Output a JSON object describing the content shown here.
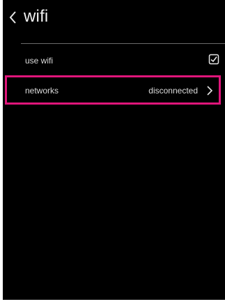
{
  "header": {
    "back_icon": "chevron-left-icon",
    "title": "wifi"
  },
  "settings": {
    "use_wifi": {
      "label": "use wifi",
      "checked": true,
      "icon": "checkbox-checked-icon"
    },
    "networks": {
      "label": "networks",
      "value": "disconnected",
      "icon": "chevron-right-icon",
      "highlighted": true
    }
  },
  "colors": {
    "background": "#000000",
    "text": "#e6e6e6",
    "highlight": "#e0157a"
  }
}
